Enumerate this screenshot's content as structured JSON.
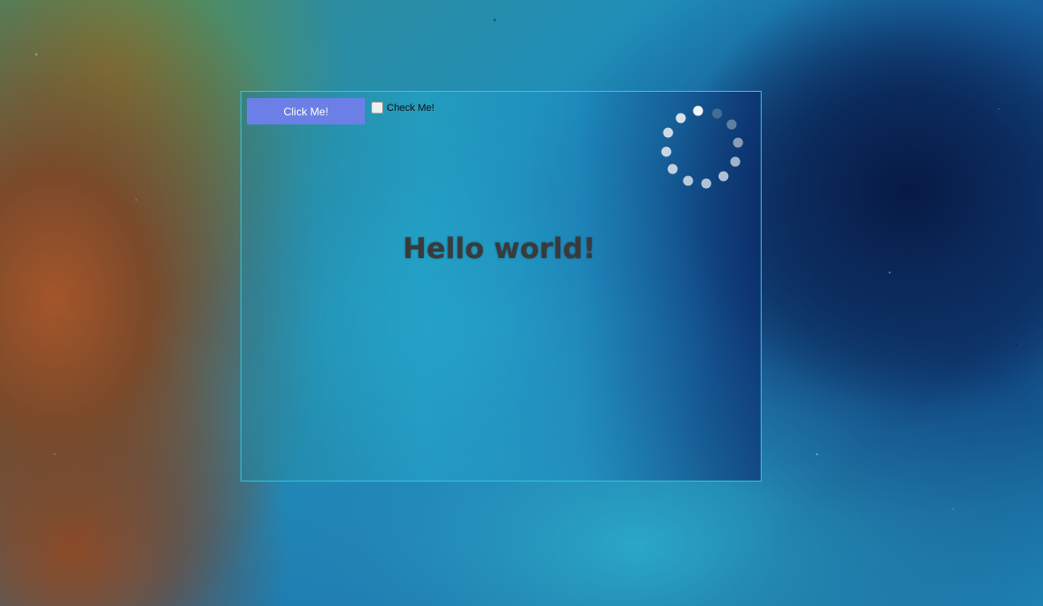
{
  "window": {
    "border_color": "#2fc6de"
  },
  "controls": {
    "button_label": "Click Me!",
    "button_color": "#6b7fe6",
    "checkbox_label": "Check Me!",
    "checkbox_checked": false
  },
  "content": {
    "headline": "Hello world!"
  },
  "spinner": {
    "icon": "loading-spinner-icon",
    "dot_count": 12
  }
}
